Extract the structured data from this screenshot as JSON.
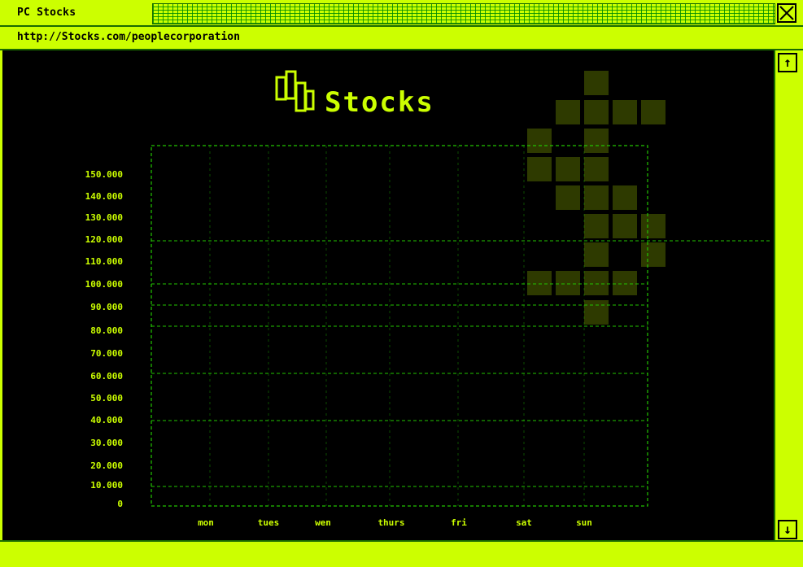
{
  "window": {
    "title": "PC Stocks",
    "close_icon": "close-icon"
  },
  "address": {
    "url": "http://Stocks.com/peoplecorporation"
  },
  "page": {
    "heading": "Stocks",
    "logo_icon": "candlestick-icon",
    "decoration_icon": "dollar-sign-pixel-icon"
  },
  "scrollbar": {
    "up_icon": "up-arrow-icon",
    "down_icon": "down-arrow-icon",
    "up_glyph": "↑",
    "down_glyph": "↓"
  },
  "colors": {
    "accent": "#ccff00",
    "grid": "#22c400",
    "background": "#000000",
    "decoration": "#2e3a00"
  },
  "chart_data": {
    "type": "line",
    "title": "",
    "xlabel": "",
    "ylabel": "",
    "categories": [
      "mon",
      "tues",
      "wen",
      "thurs",
      "fri",
      "sat",
      "sun"
    ],
    "y_ticks": [
      "150.000",
      "140.000",
      "130.000",
      "120.000",
      "110.000",
      "100.000",
      "90.000",
      "80.000",
      "70.000",
      "60.000",
      "50.000",
      "40.000",
      "30.000",
      "20.000",
      "10.000",
      "0"
    ],
    "ylim": [
      0,
      150000
    ],
    "grid": true,
    "series": []
  }
}
